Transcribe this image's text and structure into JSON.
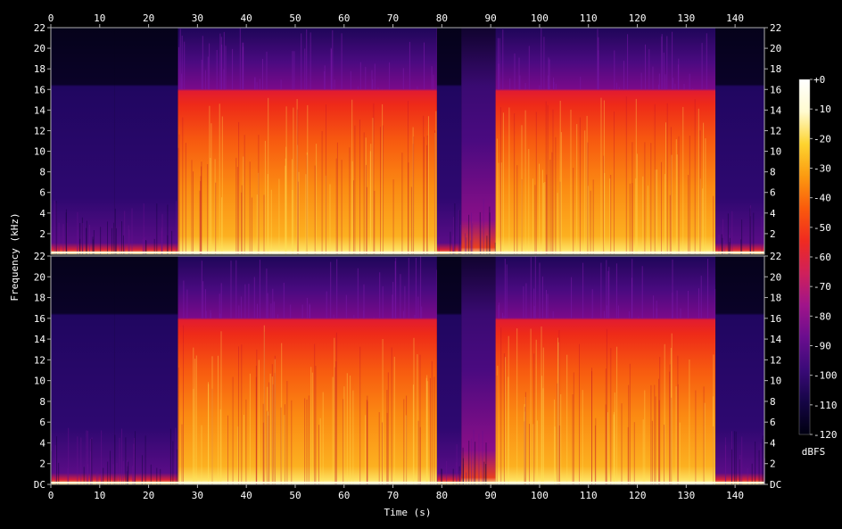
{
  "chart_data": {
    "type": "heatmap",
    "xlabel": "Time (s)",
    "ylabel": "Frequency (kHz)",
    "colorbar_label": "dBFS",
    "x_ticks": [
      0,
      10,
      20,
      30,
      40,
      50,
      60,
      70,
      80,
      90,
      100,
      110,
      120,
      130,
      140
    ],
    "xlim": [
      0,
      146
    ],
    "y_ticks_top": [
      "22",
      "20",
      "18",
      "16",
      "14",
      "12",
      "10",
      "8",
      "6",
      "4",
      "2"
    ],
    "y_ticks_bottom": [
      "22",
      "20",
      "18",
      "16",
      "14",
      "12",
      "10",
      "8",
      "6",
      "4",
      "2",
      "DC"
    ],
    "ylim_khz": [
      0,
      22
    ],
    "colorbar_ticks": [
      "+0",
      "-10",
      "-20",
      "-30",
      "-40",
      "-50",
      "-60",
      "-70",
      "-80",
      "-90",
      "-100",
      "-110",
      "-120"
    ],
    "colorbar_range_dbfs": [
      -120,
      0
    ],
    "colormap": [
      "#000010",
      "#150545",
      "#3a0a78",
      "#6a0d8e",
      "#a0148a",
      "#d0205a",
      "#f02a20",
      "#fa5a0c",
      "#fc9a10",
      "#fdd430",
      "#fffbd0",
      "#ffffff"
    ],
    "channels": [
      {
        "segments": [
          {
            "t": [
              0,
              13
            ],
            "level": "low",
            "upper_khz": 16.5
          },
          {
            "t": [
              13,
              26
            ],
            "level": "low",
            "upper_khz": 16.5
          },
          {
            "t": [
              26,
              79
            ],
            "level": "high",
            "upper_khz": 16
          },
          {
            "t": [
              79,
              84
            ],
            "level": "low",
            "upper_khz": 16.5
          },
          {
            "t": [
              84,
              91
            ],
            "level": "mid",
            "upper_khz": 16.5
          },
          {
            "t": [
              91,
              136
            ],
            "level": "high",
            "upper_khz": 16
          },
          {
            "t": [
              136,
              146
            ],
            "level": "low",
            "upper_khz": 16.5
          }
        ]
      },
      {
        "segments": [
          {
            "t": [
              0,
              13
            ],
            "level": "low",
            "upper_khz": 16.5
          },
          {
            "t": [
              13,
              26
            ],
            "level": "low",
            "upper_khz": 16.5
          },
          {
            "t": [
              26,
              79
            ],
            "level": "high",
            "upper_khz": 16
          },
          {
            "t": [
              79,
              84
            ],
            "level": "low",
            "upper_khz": 16.5
          },
          {
            "t": [
              84,
              91
            ],
            "level": "mid",
            "upper_khz": 16.5
          },
          {
            "t": [
              91,
              136
            ],
            "level": "high",
            "upper_khz": 16
          },
          {
            "t": [
              136,
              146
            ],
            "level": "low",
            "upper_khz": 16.5
          }
        ]
      }
    ]
  }
}
